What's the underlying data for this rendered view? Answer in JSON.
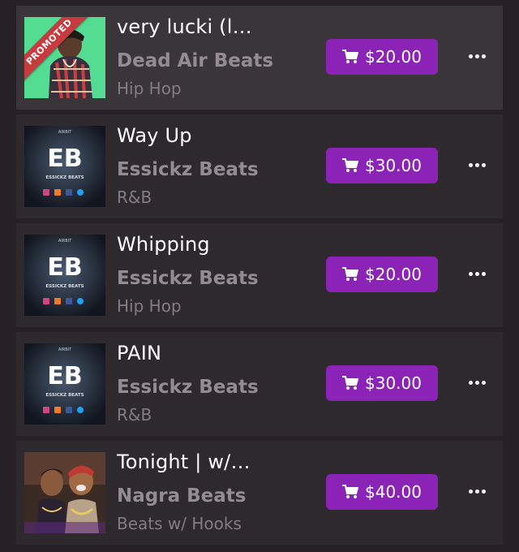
{
  "colors": {
    "background": "#272126",
    "row": "#2d292d",
    "row_highlight": "#3a3539",
    "accent": "#8b23b6",
    "promoted": "#c93a3e",
    "artist_text": "#948b93"
  },
  "promoted_label": "PROMOTED",
  "beats": [
    {
      "title": "very lucki (l…",
      "artist": "Dead Air Beats",
      "genre": "Hip Hop",
      "price": "$20.00",
      "promoted": true,
      "cover_icon": "artist-photo-icon"
    },
    {
      "title": "Way Up",
      "artist": "Essickz Beats",
      "genre": "R&B",
      "price": "$30.00",
      "promoted": false,
      "cover_icon": "eb-logo-icon"
    },
    {
      "title": "Whipping",
      "artist": "Essickz Beats",
      "genre": "Hip Hop",
      "price": "$20.00",
      "promoted": false,
      "cover_icon": "eb-logo-icon"
    },
    {
      "title": "PAIN",
      "artist": "Essickz Beats",
      "genre": "R&B",
      "price": "$30.00",
      "promoted": false,
      "cover_icon": "eb-logo-icon"
    },
    {
      "title": "Tonight | w/…",
      "artist": "Nagra Beats",
      "genre": "Beats w/ Hooks",
      "price": "$40.00",
      "promoted": false,
      "cover_icon": "artists-photo-icon"
    }
  ],
  "cover_text": {
    "brand": "ESSICKZ BEATS",
    "tag": "AIRBIT",
    "logo": "EB"
  },
  "icons": {
    "buy": "shopping-cart-icon",
    "more": "more-options-icon"
  }
}
